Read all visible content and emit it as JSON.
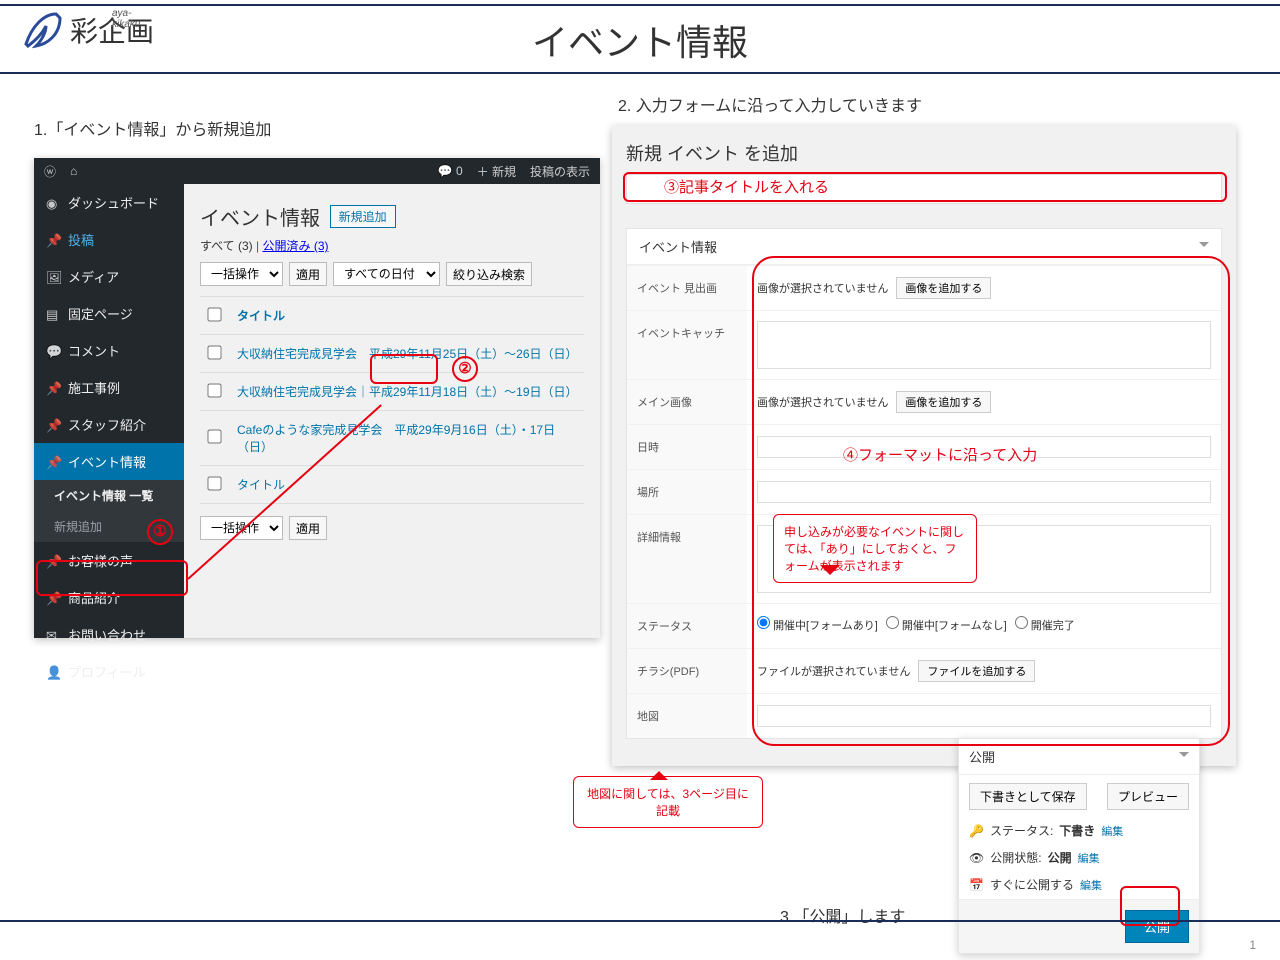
{
  "brand": {
    "sub": "aya-kikaku",
    "name": "彩企画"
  },
  "page": {
    "title": "イベント情報",
    "number": "1"
  },
  "steps": {
    "s1": "1.「イベント情報」から新規追加",
    "s2": "2. 入力フォームに沿って入力していきます",
    "s3": "3.「公開」します"
  },
  "callouts": {
    "c1": "①",
    "c2": "②",
    "c3_label": "③記事タイトルを入れる",
    "c4_label": "④フォーマットに沿って入力",
    "speech_status": "申し込みが必要なイベントに関しては、「あり」にしておくと、フォームが表示されます",
    "speech_map": "地図に関しては、3ページ目に記載"
  },
  "wp_left": {
    "toolbar": {
      "comment_count": "0",
      "new": "＋ 新規",
      "display": "投稿の表示"
    },
    "sidebar": {
      "dashboard": "ダッシュボード",
      "posts": "投稿",
      "media": "メディア",
      "pages": "固定ページ",
      "comments": "コメント",
      "works": "施工事例",
      "staff": "スタッフ紹介",
      "events": "イベント情報",
      "events_list": "イベント情報 一覧",
      "events_new": "新規追加",
      "voice": "お客様の声",
      "products": "商品紹介",
      "contact": "お問い合わせ",
      "profile": "プロフィール"
    },
    "content": {
      "heading": "イベント情報",
      "new_btn": "新規追加",
      "all": "すべて (3)",
      "published": "公開済み (3)",
      "bulk": "一括操作",
      "apply": "適用",
      "all_dates": "すべての日付",
      "filter": "絞り込み検索",
      "col_title": "タイトル",
      "rows": [
        "大収納住宅完成見学会　平成29年11月25日（土）～26日（日）",
        "大収納住宅完成見学会｜平成29年11月18日（土）～19日（日）",
        "Cafeのような家完成見学会　平成29年9月16日（土）・17日（日）"
      ],
      "bulk2": "一括操作",
      "apply2": "適用"
    }
  },
  "wp_right": {
    "heading": "新規 イベント を追加",
    "box_title": "イベント情報",
    "fields": {
      "gallery_label": "イベント 見出画",
      "gallery_note": "画像が選択されていません",
      "gallery_btn": "画像を追加する",
      "catch_label": "イベントキャッチ",
      "main_img_label": "メイン画像",
      "main_img_note": "画像が選択されていません",
      "main_img_btn": "画像を追加する",
      "date_label": "日時",
      "place_label": "場所",
      "detail_label": "詳細情報",
      "status_label": "ステータス",
      "status1": "開催中[フォームあり]",
      "status2": "開催中[フォームなし]",
      "status3": "開催完了",
      "pdf_label": "チラシ(PDF)",
      "pdf_note": "ファイルが選択されていません",
      "pdf_btn": "ファイルを追加する",
      "map_label": "地図"
    }
  },
  "publish": {
    "title": "公開",
    "save_draft": "下書きとして保存",
    "preview": "プレビュー",
    "status_pre": "ステータス:",
    "status_val": "下書き",
    "vis_pre": "公開状態:",
    "vis_val": "公開",
    "sched": "すぐに公開する",
    "edit": "編集",
    "publish_btn": "公開"
  }
}
